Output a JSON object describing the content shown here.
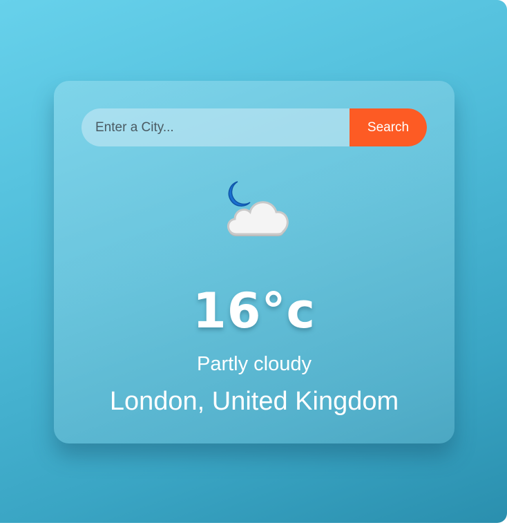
{
  "search": {
    "placeholder": "Enter a City...",
    "value": "",
    "button_label": "Search"
  },
  "weather": {
    "icon": "partly-cloudy-night-icon",
    "temperature": "16°c",
    "condition": "Partly cloudy",
    "location": "London, United Kingdom"
  },
  "colors": {
    "background_top": "#67d1eb",
    "background_bottom": "#2a8fae",
    "button": "#fd5b24",
    "moon": "#1a6fd0",
    "text": "#ffffff"
  }
}
